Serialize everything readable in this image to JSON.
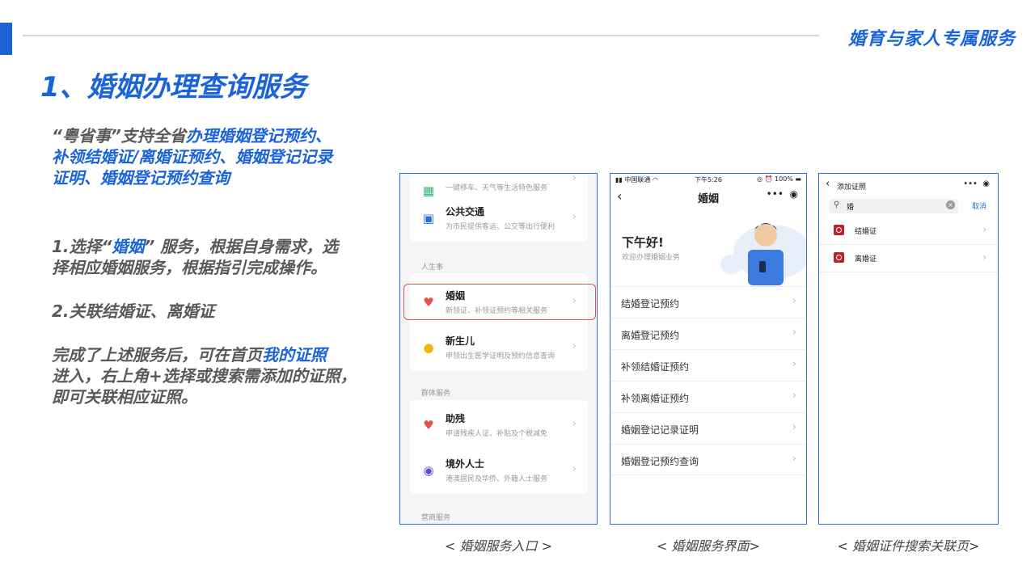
{
  "header": {
    "brand": "婚育与家人专属服务"
  },
  "title": "1、婚姻办理查询服务",
  "intro": {
    "p1_prefix": "“粤省事”支持全省",
    "p1_link1": "办理婚姻登记预约、",
    "p1_line2": "补领结婚证/离婚证预约、婚姻登记记录",
    "p1_line3": "证明、婚姻登记预约查询"
  },
  "step1": {
    "a": "1.选择“",
    "b": "婚姻",
    "c": "” 服务，根据自身需求，选",
    "line2": "择相应婚姻服务，根据指引完成操作。"
  },
  "step2": "2.关联结婚证、离婚证",
  "step3": {
    "a": "完成了上述服务后，可在首页",
    "b": "我的证照",
    "line2": "进入，右上角+选择或搜索需添加的证照，",
    "line3": "即可关联相应证照。"
  },
  "shot1": {
    "top_desc": "一键移车、天气等生活特色服务",
    "transit": {
      "name": "公共交通",
      "desc": "为市民提供客运、公交等出行便利"
    },
    "section1": "人生事",
    "marriage": {
      "name": "婚姻",
      "desc": "新领证、补领证预约等相关服务"
    },
    "baby": {
      "name": "新生儿",
      "desc": "申领出生医学证明及预约信息查询"
    },
    "section2": "群体服务",
    "disabled": {
      "name": "助残",
      "desc": "申请残疾人证、补贴及个税减免"
    },
    "foreign": {
      "name": "境外人士",
      "desc": "港澳居民及华侨、外籍人士服务"
    },
    "section3": "营商服务",
    "caption": "< 婚姻服务入口 >"
  },
  "shot2": {
    "carrier": "中国联通",
    "time": "下午5:26",
    "battery": "100%",
    "nav_title": "婚姻",
    "greeting": "下午好!",
    "welcome": "欢迎办理婚姻业务",
    "menu": [
      "结婚登记预约",
      "离婚登记预约",
      "补领结婚证预约",
      "补领离婚证预约",
      "婚姻登记记录证明",
      "婚姻登记预约查询"
    ],
    "caption": "< 婚姻服务界面>"
  },
  "shot3": {
    "header": "添加证照",
    "query": "婚",
    "cancel": "取消",
    "results": [
      "结婚证",
      "离婚证"
    ],
    "caption": "< 婚姻证件搜索关联页>"
  }
}
